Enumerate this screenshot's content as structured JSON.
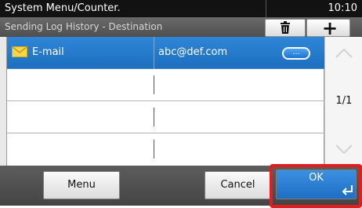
{
  "header": {
    "title": "System Menu/Counter.",
    "time": "10:10"
  },
  "subheader": {
    "title": "Sending Log History - Destination"
  },
  "toolbar": {
    "delete_icon": "trash-icon",
    "add_icon": "plus-icon",
    "add_symbol": "+"
  },
  "list": {
    "rows": [
      {
        "type": "E-mail",
        "address": "abc@def.com",
        "selected": true,
        "detail_label": "..."
      },
      {
        "type": "",
        "address": "",
        "selected": false
      },
      {
        "type": "",
        "address": "",
        "selected": false
      },
      {
        "type": "",
        "address": "",
        "selected": false
      }
    ]
  },
  "scroll": {
    "page": "1/1"
  },
  "footer": {
    "menu_label": "Menu",
    "cancel_label": "Cancel",
    "ok_label": "OK"
  },
  "colors": {
    "selected_row": "#1d6fc0",
    "highlight": "#e31d1d"
  }
}
